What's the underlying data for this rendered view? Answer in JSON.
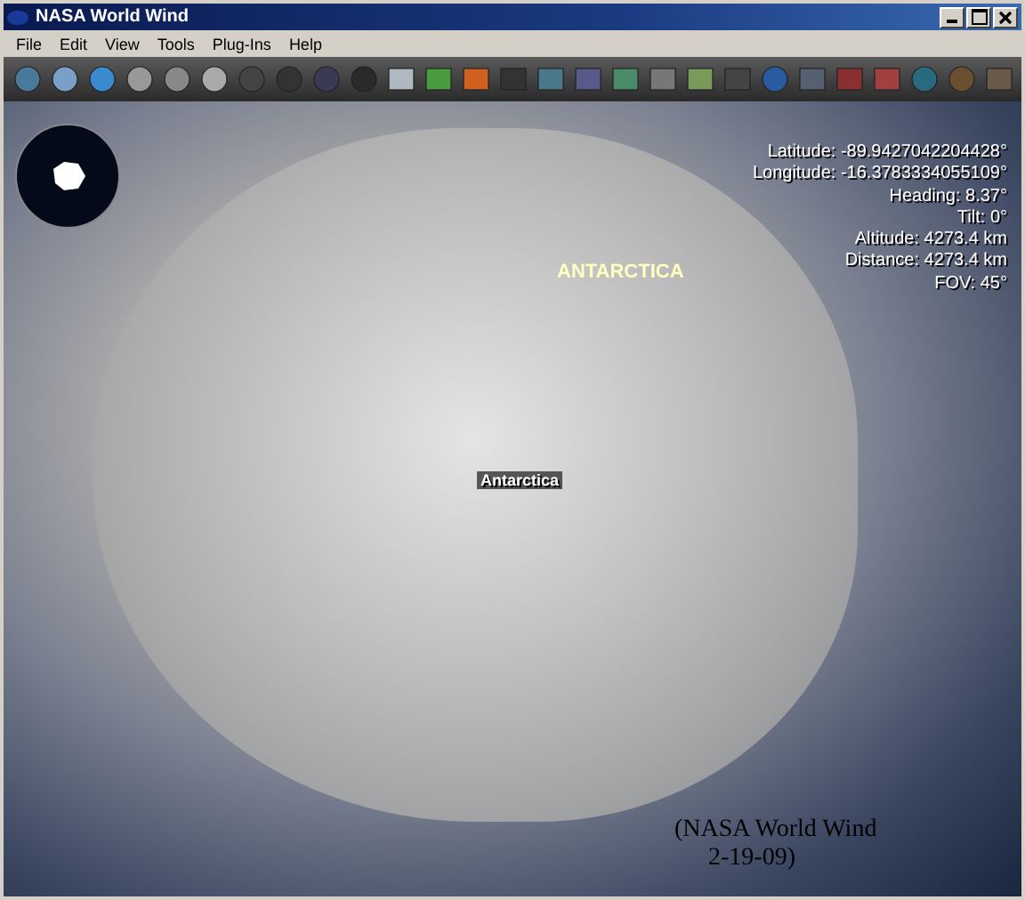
{
  "window": {
    "title": "NASA World Wind"
  },
  "menu": [
    "File",
    "Edit",
    "View",
    "Tools",
    "Plug-Ins",
    "Help"
  ],
  "globe": {
    "region_label": "ANTARCTICA",
    "place_label": "Antarctica",
    "readout": [
      "Latitude: -89.9427042204428°",
      "Longitude: -16.3783334055109°",
      "Heading: 8.37°",
      "Tilt: 0°",
      "Altitude: 4273.4 km",
      "Distance: 4273.4 km",
      "FOV: 45°"
    ],
    "caption": [
      "(NASA World Wind",
      "2-19-09)"
    ]
  }
}
